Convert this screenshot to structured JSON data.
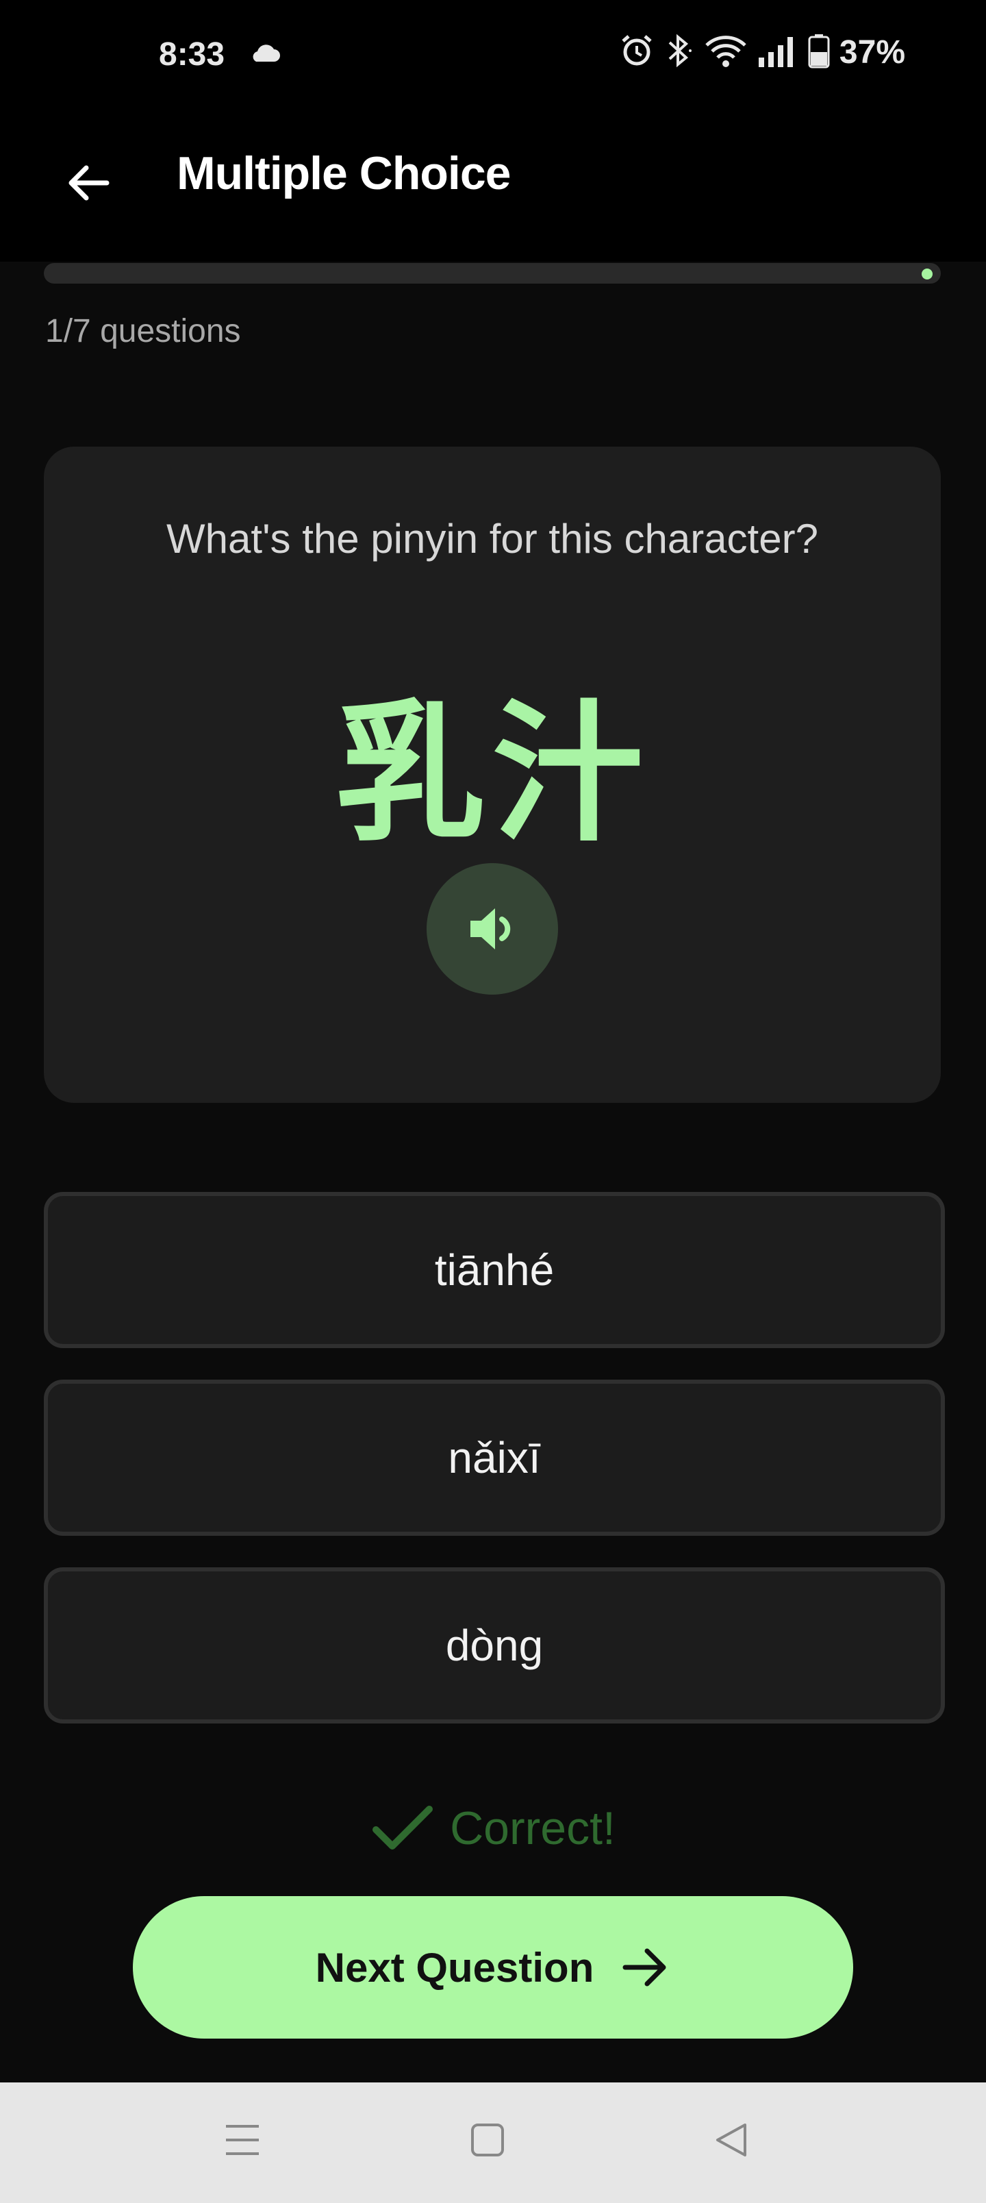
{
  "status_bar": {
    "time": "8:33",
    "battery": "37%",
    "icons": [
      "cloud-icon",
      "alarm-icon",
      "bluetooth-icon",
      "wifi-icon",
      "signal-icon",
      "battery-icon"
    ]
  },
  "app_bar": {
    "title": "Multiple Choice",
    "back_icon": "arrow-left-icon"
  },
  "progress": {
    "label": "1/7 questions",
    "value": 0.14
  },
  "question": {
    "prompt": "What's the pinyin for this character?",
    "character": "乳汁",
    "audio_icon": "speaker-icon"
  },
  "options": [
    {
      "label": "tiānhé"
    },
    {
      "label": "nǎixī"
    },
    {
      "label": "dòng"
    }
  ],
  "feedback": {
    "text": "Correct!",
    "icon": "check-icon"
  },
  "next_button": {
    "label": "Next Question",
    "icon": "arrow-right-icon"
  },
  "nav_bar": {
    "icons": [
      "menu-icon",
      "home-icon",
      "back-icon"
    ]
  },
  "colors": {
    "accent": "#acf8a2",
    "character": "#a9f4a5",
    "card": "#1e1e1e",
    "correct": "#2f6a2f"
  }
}
